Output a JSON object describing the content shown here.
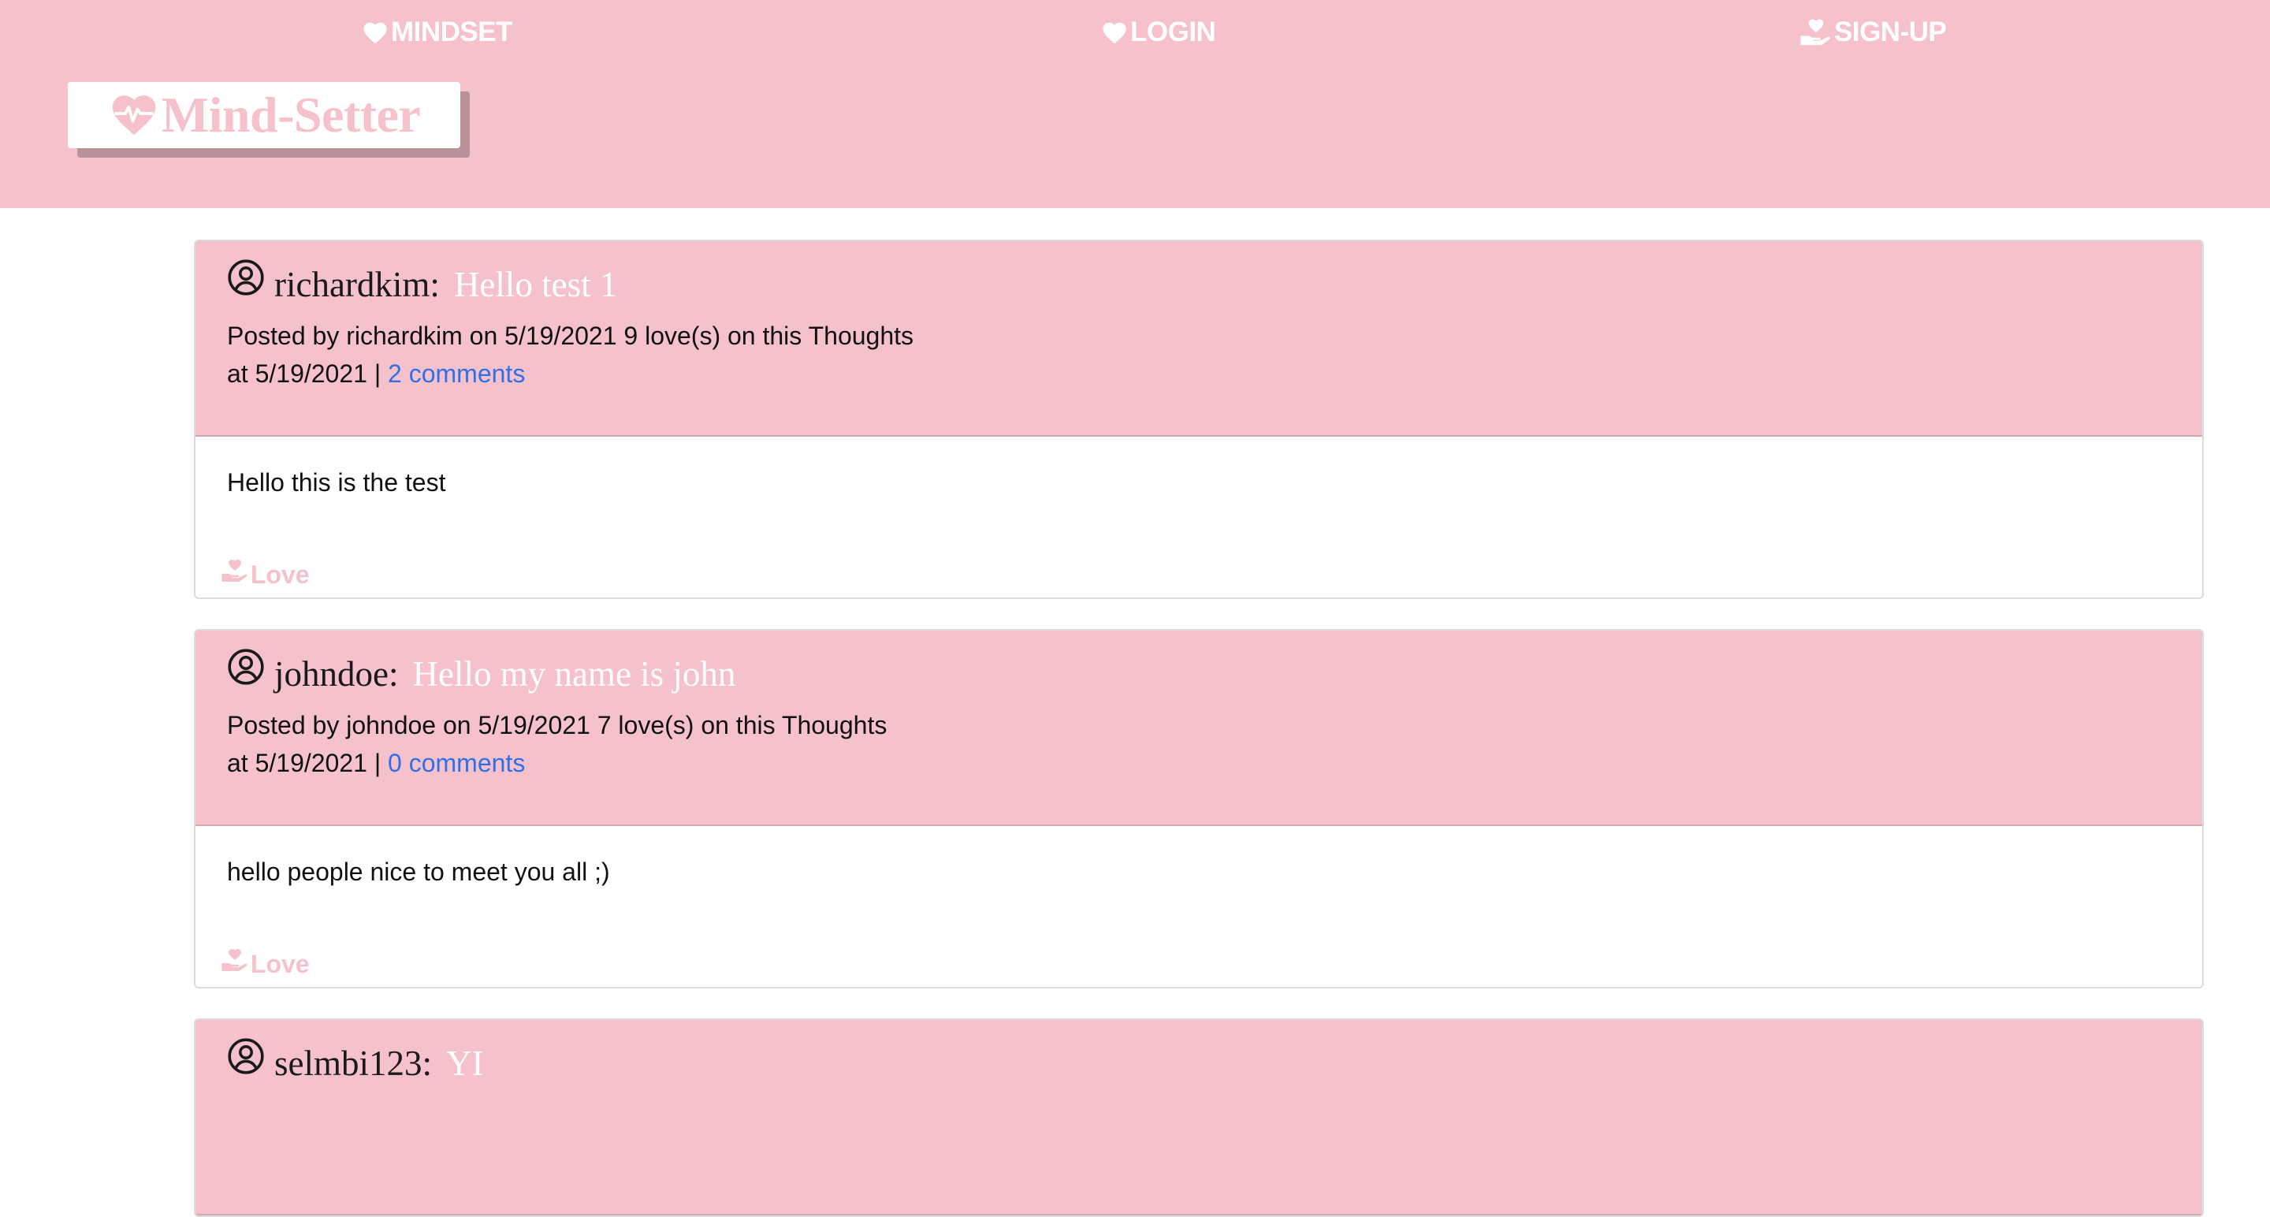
{
  "nav": {
    "mindset_label": "MINDSET",
    "login_label": "LOGIN",
    "signup_label": "SIGN-UP"
  },
  "logo": {
    "text": "Mind-Setter"
  },
  "colors": {
    "brand_pink": "#f5c2cb",
    "link_blue": "#2f6fe8",
    "logo_shadow": "#b89199"
  },
  "posts": [
    {
      "username": "richardkim:",
      "title": "Hello test 1",
      "meta_line1": "Posted by richardkim on 5/19/2021 9 love(s) on this Thoughts",
      "meta_line2_prefix": "at 5/19/2021 |",
      "comments_link": "2 comments",
      "body": "Hello this is the test",
      "love_label": "Love"
    },
    {
      "username": "johndoe:",
      "title": "Hello my name is john",
      "meta_line1": "Posted by johndoe on 5/19/2021 7 love(s) on this Thoughts",
      "meta_line2_prefix": "at 5/19/2021 |",
      "comments_link": "0 comments",
      "body": "hello people nice to meet you all ;)",
      "love_label": "Love"
    },
    {
      "username": "selmbi123:",
      "title": "YI"
    }
  ]
}
